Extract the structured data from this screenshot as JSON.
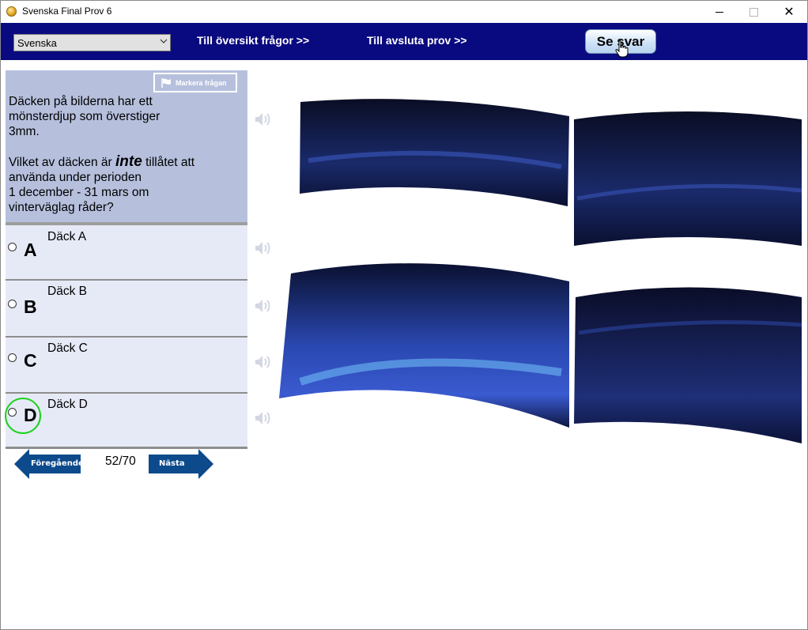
{
  "window": {
    "title": "Svenska Final Prov 6",
    "close_glyph": "✕"
  },
  "toolbar": {
    "language_selected": "Svenska",
    "overview_link": "Till översikt frågor >>",
    "finish_link": "Till avsluta prov  >>",
    "show_answer": "Se svar"
  },
  "question": {
    "mark_label": "Markera frågan",
    "line1": "Däcken på bilderna har ett",
    "line2": "mönsterdjup som överstiger",
    "line3": "3mm.",
    "line4_pre": "Vilket av däcken är ",
    "line4_emph": "inte",
    "line4_post": " tillåtet att",
    "line5": "använda under perioden",
    "line6": "1 december - 31 mars om",
    "line7": "vinterväglag råder?"
  },
  "answers": [
    {
      "letter": "A",
      "text": "Däck A"
    },
    {
      "letter": "B",
      "text": "Däck B"
    },
    {
      "letter": "C",
      "text": "Däck C"
    },
    {
      "letter": "D",
      "text": "Däck D"
    }
  ],
  "navigation": {
    "prev_label": "Föregående",
    "next_label": "Nästa",
    "counter": "52/70"
  },
  "colors": {
    "toolbar_bg": "#0a0a80",
    "question_bg": "#b6c0dd",
    "answer_bg": "#e6eaf7",
    "highlight": "#1bd21b"
  },
  "icons": [
    "app-icon",
    "minimize-icon",
    "maximize-icon",
    "close-icon",
    "flag-icon",
    "speaker-icon",
    "hand-cursor-icon",
    "arrow-left-icon",
    "arrow-right-icon"
  ]
}
